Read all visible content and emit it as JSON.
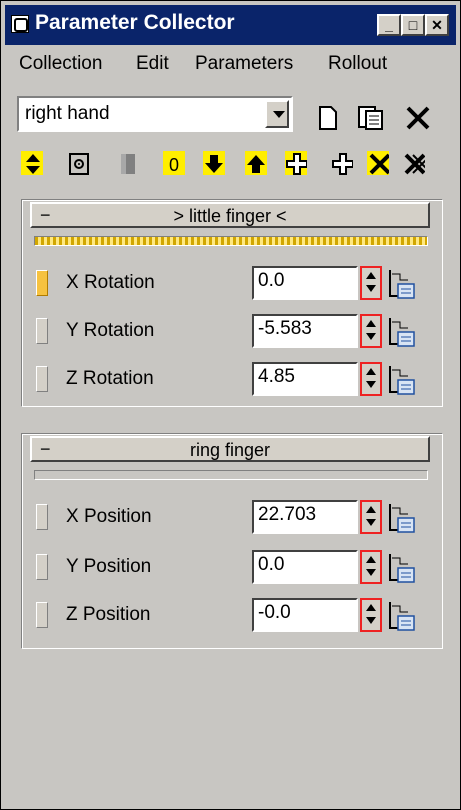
{
  "window": {
    "title": "Parameter Collector",
    "buttons": [
      "minimize-button",
      "maximize-button",
      "close-button"
    ]
  },
  "menu": [
    "Collection",
    "Edit",
    "Parameters",
    "Rollout"
  ],
  "collection": {
    "selected": "right hand"
  },
  "toolbar_icons": [
    "move-up-down-icon",
    "select-object-icon",
    "rollout-icon",
    "zero-icon",
    "move-down-icon",
    "move-up-icon",
    "add-selected-icon",
    "add-icon",
    "delete-selected-icon",
    "delete-all-icon"
  ],
  "rollouts": [
    {
      "header": "> little finger <",
      "collapse_symbol": "−",
      "active": true,
      "params": [
        {
          "label": "X Rotation",
          "value": "0.0",
          "selected": true
        },
        {
          "label": "Y Rotation",
          "value": "-5.583",
          "selected": false
        },
        {
          "label": "Z Rotation",
          "value": "4.85",
          "selected": false
        }
      ]
    },
    {
      "header": "ring finger",
      "collapse_symbol": "−",
      "active": false,
      "params": [
        {
          "label": "X Position",
          "value": "22.703",
          "selected": false
        },
        {
          "label": "Y Position",
          "value": "0.0",
          "selected": false
        },
        {
          "label": "Z Position",
          "value": "-0.0",
          "selected": false
        }
      ]
    }
  ],
  "colors": {
    "titlebar": "#0a246a",
    "highlight": "#ffee00",
    "selected_handle": "#f6c240",
    "spinner_border": "#e22222"
  }
}
